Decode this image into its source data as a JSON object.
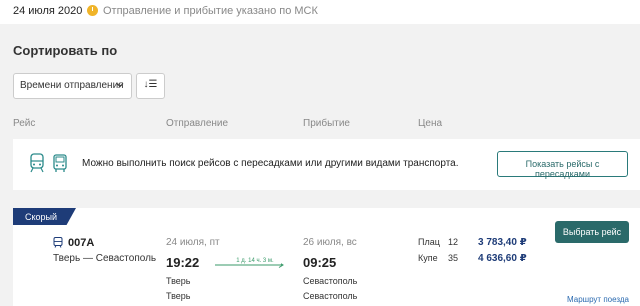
{
  "topbar": {
    "date": "24 июля 2020",
    "timezone_note": "Отправление и прибытие указано по МСК"
  },
  "sort": {
    "title": "Сортировать по",
    "selected": "Времени отправления",
    "toggle_label": "↓☰"
  },
  "columns": [
    "Рейс",
    "Отправление",
    "Прибытие",
    "Цена"
  ],
  "notice": {
    "message": "Можно выполнить поиск рейсов с пересадками или другими видами транспорта.",
    "button_label": "Показать рейсы с пересадками"
  },
  "train": {
    "badge": "Скорый",
    "number": "007А",
    "route": "Тверь — Севастополь",
    "departure": {
      "date": "24 июля, пт",
      "time": "19:22",
      "city": "Тверь",
      "station": "Тверь"
    },
    "duration": "1 д. 14 ч. 3 м.",
    "arrival": {
      "date": "26 июля, вс",
      "time": "09:25",
      "city": "Севастополь",
      "station": "Севастополь"
    },
    "fares": [
      {
        "class": "Плац",
        "count": "12",
        "price": "3 783,40 ₽"
      },
      {
        "class": "Купе",
        "count": "35",
        "price": "4 636,60 ₽"
      }
    ],
    "select_button": "Выбрать рейс",
    "route_link": "Маршрут поезда"
  },
  "colors": {
    "accent": "#2a6a6a",
    "badge": "#1e3c78",
    "price": "#1e3c78",
    "clock": "#f0b429"
  }
}
